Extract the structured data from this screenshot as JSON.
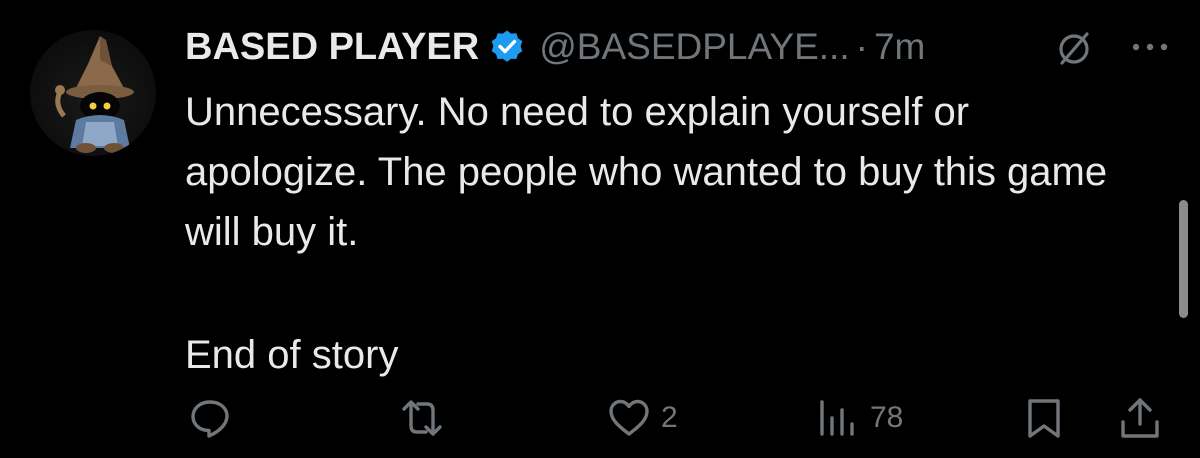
{
  "tweet": {
    "author": {
      "display_name": "BASED PLAYER",
      "handle": "@BASEDPLAYE...",
      "verified": true,
      "avatar": "wizard-avatar"
    },
    "separator": "·",
    "timestamp": "7m",
    "body": {
      "paragraph_1": "Unnecessary. No need to explain yourself or apologize. The people who wanted to buy this game will buy it.",
      "paragraph_2": "End of story"
    },
    "actions": {
      "reply": {
        "icon": "reply-icon",
        "count": ""
      },
      "repost": {
        "icon": "repost-icon",
        "count": ""
      },
      "like": {
        "icon": "heart-icon",
        "count": "2"
      },
      "views": {
        "icon": "views-icon",
        "count": "78"
      },
      "bookmark": {
        "icon": "bookmark-icon"
      },
      "share": {
        "icon": "share-icon"
      }
    }
  },
  "colors": {
    "background": "#000000",
    "text_primary": "#e7e9ea",
    "text_secondary": "#71767b",
    "verified_blue": "#1d9bf0"
  }
}
